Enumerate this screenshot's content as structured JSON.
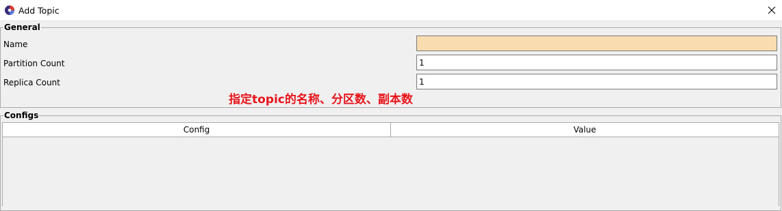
{
  "window": {
    "title": "Add Topic",
    "close_glyph": "✕",
    "icon": "app-logo-icon"
  },
  "general": {
    "legend": "General",
    "fields": {
      "name": {
        "label": "Name",
        "value": ""
      },
      "partition_count": {
        "label": "Partition Count",
        "value": "1"
      },
      "replica_count": {
        "label": "Replica Count",
        "value": "1"
      }
    }
  },
  "annotation": {
    "text": "指定topic的名称、分区数、副本数",
    "color": "#e8141b"
  },
  "configs": {
    "legend": "Configs",
    "columns": [
      "Config",
      "Value"
    ],
    "rows": []
  },
  "colors": {
    "name_field_highlight": "#fadcb1",
    "background": "#f0f0f0"
  }
}
